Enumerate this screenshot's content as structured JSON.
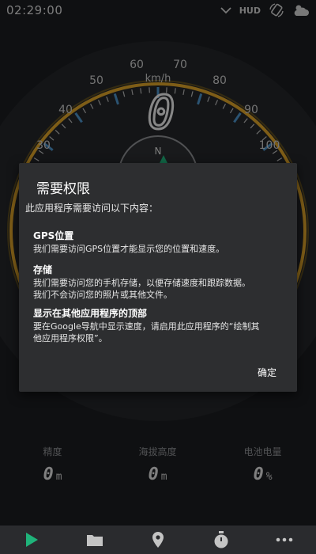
{
  "status_bar": {
    "time": "02:29:00",
    "hud_label": "HUD",
    "icons": [
      "chevron-down-icon",
      "rotate-icon",
      "weather-icon"
    ]
  },
  "speedometer": {
    "unit": "km/h",
    "speed_value": "0",
    "tick_labels": [
      "30",
      "40",
      "50",
      "60",
      "70",
      "80",
      "90",
      "100"
    ],
    "compass_letter": "N",
    "accent_color": "#d9a029",
    "tick_color": "#4a8fc4"
  },
  "stats": [
    {
      "label": "精度",
      "value": "0",
      "unit": "m"
    },
    {
      "label": "海拔高度",
      "value": "0",
      "unit": "m"
    },
    {
      "label": "电池电量",
      "value": "0",
      "unit": "%"
    }
  ],
  "bottom_nav": {
    "items": [
      "play-icon",
      "folder-icon",
      "map-pin-icon",
      "stopwatch-icon",
      "more-icon"
    ],
    "play_color": "#1fb37a"
  },
  "dialog": {
    "title": "需要权限",
    "intro": "此应用程序需要访问以下内容：",
    "sections": [
      {
        "heading": "GPS位置",
        "lines": [
          "我们需要访问GPS位置才能显示您的位置和速度。"
        ]
      },
      {
        "heading": "存储",
        "lines": [
          "我们需要访问您的手机存储，以便存储速度和跟踪数据。",
          "我们不会访问您的照片或其他文件。"
        ]
      },
      {
        "heading": "显示在其他应用程序的顶部",
        "lines": [
          "要在Google导航中显示速度，请启用此应用程序的“绘制其",
          "他应用程序权限”。"
        ]
      }
    ],
    "ok_label": "确定"
  }
}
